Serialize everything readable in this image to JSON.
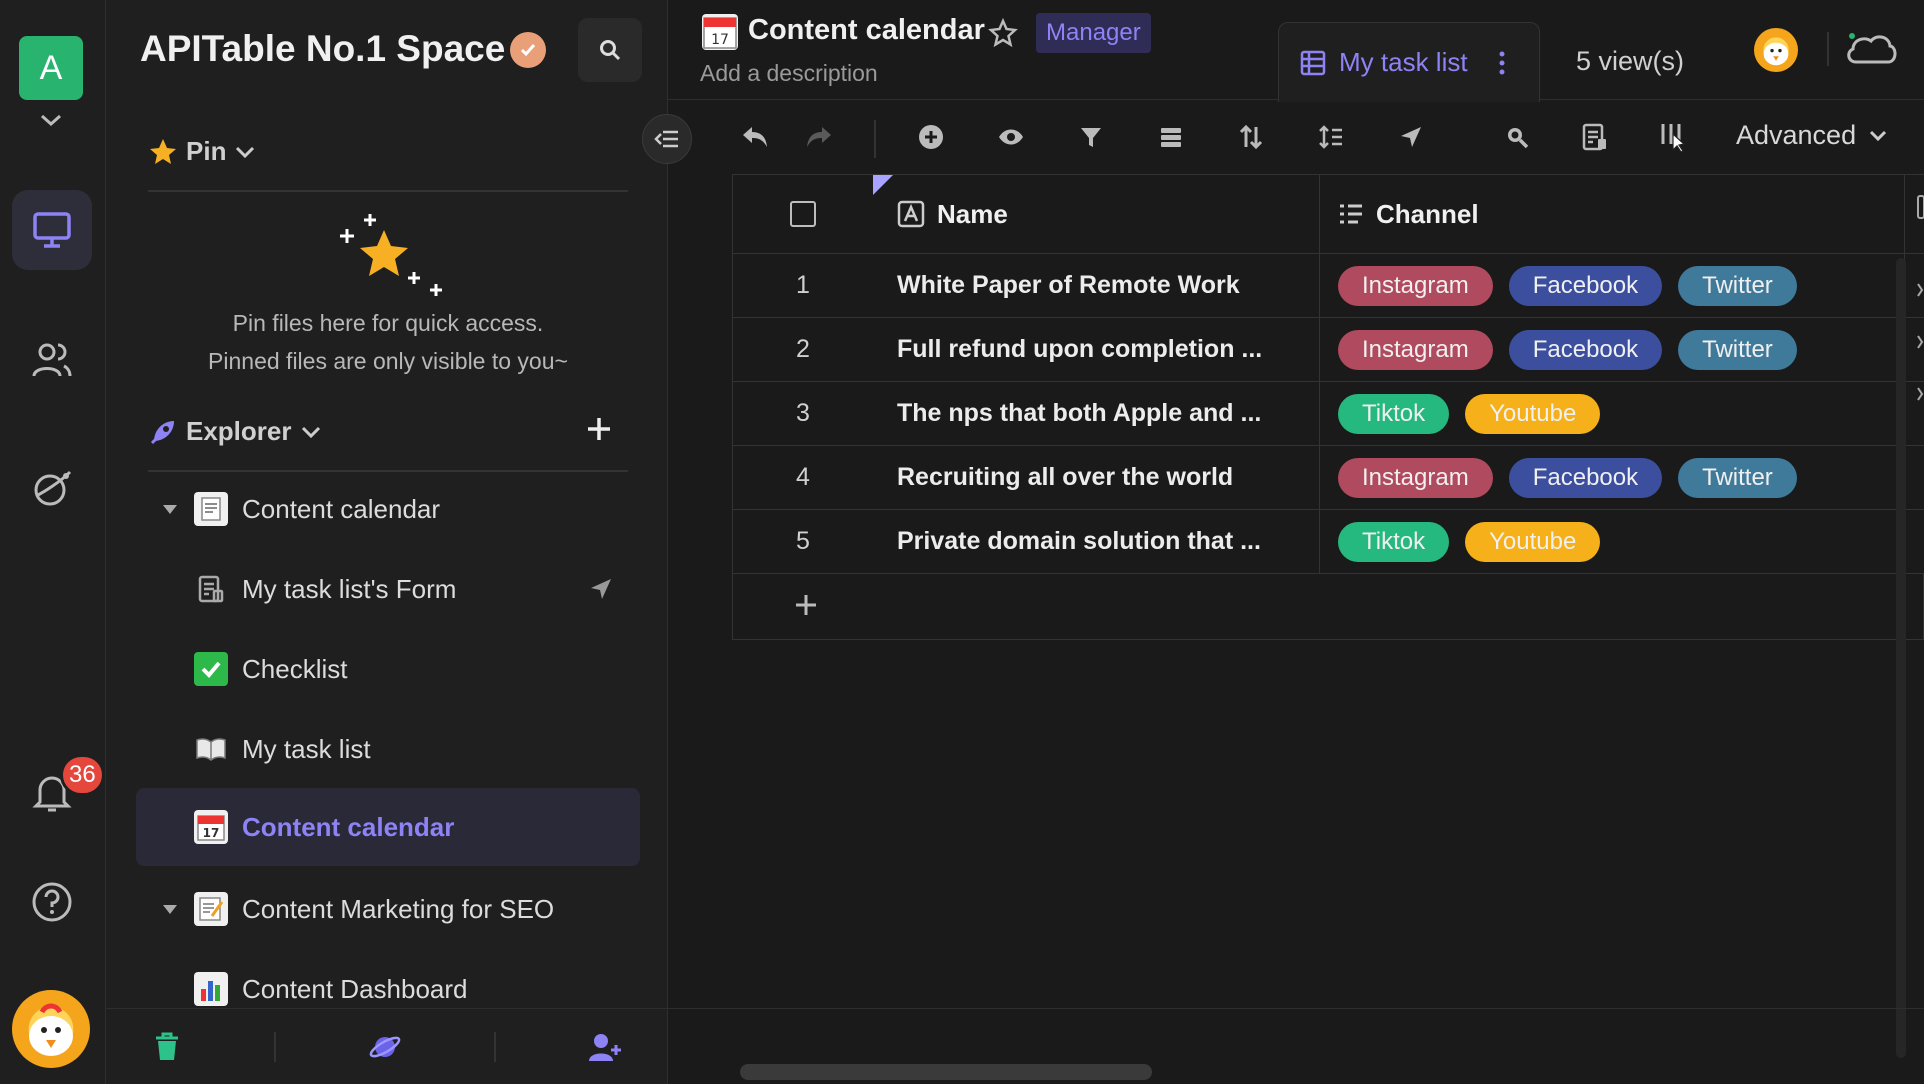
{
  "rail": {
    "space_initial": "A",
    "notification_count": "36"
  },
  "sidebar": {
    "space_name": "APITable No.1 Space",
    "pin_label": "Pin",
    "pin_empty_line1": "Pin files here for quick access.",
    "pin_empty_line2": "Pinned files are only visible to you~",
    "explorer_label": "Explorer",
    "tree": [
      {
        "label": "Content calendar",
        "icon": "receipt-icon",
        "kind": "folder"
      },
      {
        "label": "My task list's Form",
        "icon": "form-icon",
        "kind": "form"
      },
      {
        "label": "Checklist",
        "icon": "checkmark-icon",
        "kind": "datasheet"
      },
      {
        "label": "My task list",
        "icon": "book-icon",
        "kind": "datasheet"
      },
      {
        "label": "Content calendar",
        "icon": "calendar-icon",
        "kind": "datasheet",
        "active": true
      },
      {
        "label": "Content Marketing for SEO",
        "icon": "memo-icon",
        "kind": "folder"
      },
      {
        "label": "Content Dashboard",
        "icon": "bar-chart-icon",
        "kind": "dashboard"
      }
    ]
  },
  "header": {
    "title": "Content calendar",
    "role": "Manager",
    "description": "Add a description",
    "active_view": "My task list",
    "view_count": "5 view(s)"
  },
  "toolbar": {
    "advanced_label": "Advanced"
  },
  "grid": {
    "columns": {
      "name": "Name",
      "channel": "Channel"
    },
    "rows": [
      {
        "index": "1",
        "name": "White Paper of Remote Work",
        "channels": [
          "Instagram",
          "Facebook",
          "Twitter"
        ]
      },
      {
        "index": "2",
        "name": "Full refund upon completion ...",
        "channels": [
          "Instagram",
          "Facebook",
          "Twitter"
        ]
      },
      {
        "index": "3",
        "name": "The nps that both Apple and ...",
        "channels": [
          "Tiktok",
          "Youtube"
        ]
      },
      {
        "index": "4",
        "name": "Recruiting all over the world",
        "channels": [
          "Instagram",
          "Facebook",
          "Twitter"
        ]
      },
      {
        "index": "5",
        "name": "Private domain solution that ...",
        "channels": [
          "Tiktok",
          "Youtube"
        ]
      }
    ],
    "tag_colors": {
      "Instagram": "#b04a5e",
      "Facebook": "#3c4f9e",
      "Twitter": "#3f7a9a",
      "Tiktok": "#26b97f",
      "Youtube": "#f5b01a"
    }
  },
  "colors": {
    "accent": "#8e83f5",
    "space_green": "#28b46e",
    "badge_red": "#e5473d"
  }
}
